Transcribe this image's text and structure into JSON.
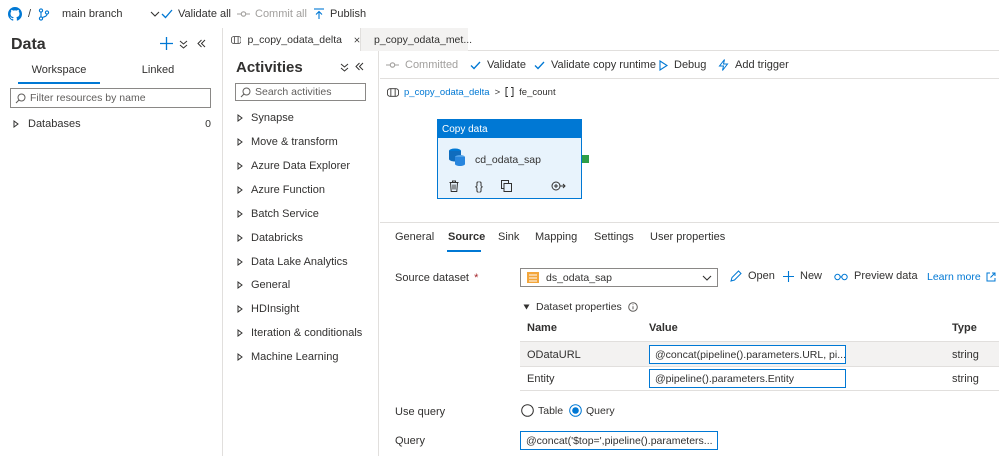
{
  "topbar": {
    "slash": "/",
    "branch": "main branch",
    "validate_all": "Validate all",
    "commit_all": "Commit all",
    "publish": "Publish"
  },
  "data_pane": {
    "title": "Data",
    "tabs": [
      "Workspace",
      "Linked"
    ],
    "search_placeholder": "Filter resources by name",
    "tree": [
      {
        "label": "Databases",
        "count": "0"
      }
    ]
  },
  "activities_pane": {
    "title": "Activities",
    "search_placeholder": "Search activities",
    "items": [
      "Synapse",
      "Move & transform",
      "Azure Data Explorer",
      "Azure Function",
      "Batch Service",
      "Databricks",
      "Data Lake Analytics",
      "General",
      "HDInsight",
      "Iteration & conditionals",
      "Machine Learning"
    ]
  },
  "pipeline_tabs": [
    {
      "label": "p_copy_odata_delta",
      "active": true
    },
    {
      "label": "p_copy_odata_met...",
      "active": false
    }
  ],
  "pipeline_toolbar": {
    "committed": "Committed",
    "validate": "Validate",
    "validate_copy_runtime": "Validate copy runtime",
    "debug": "Debug",
    "add_trigger": "Add trigger"
  },
  "breadcrumb": {
    "pipeline": "p_copy_odata_delta",
    "separator": ">",
    "activity": "fe_count"
  },
  "activity": {
    "header": "Copy data",
    "name": "cd_odata_sap"
  },
  "properties": {
    "tabs": [
      "General",
      "Source",
      "Sink",
      "Mapping",
      "Settings",
      "User properties"
    ],
    "active_tab": "Source",
    "source_dataset_label": "Source dataset",
    "required_mark": "*",
    "source_dataset_value": "ds_odata_sap",
    "open": "Open",
    "new": "New",
    "preview_data": "Preview data",
    "learn_more": "Learn more",
    "dataset_properties_label": "Dataset properties",
    "grid_headers": [
      "Name",
      "Value",
      "Type"
    ],
    "grid_rows": [
      {
        "name": "ODataURL",
        "value": "@concat(pipeline().parameters.URL, pi...",
        "type": "string"
      },
      {
        "name": "Entity",
        "value": "@pipeline().parameters.Entity",
        "type": "string"
      }
    ],
    "use_query_label": "Use query",
    "use_query_options": [
      "Table",
      "Query"
    ],
    "use_query_selected": "Query",
    "query_label": "Query",
    "query_value": "@concat('$top=',pipeline().parameters..."
  },
  "colors": {
    "accent": "#0078d4",
    "activity_body": "#e8f3fc",
    "success_port": "#2e9e48"
  }
}
